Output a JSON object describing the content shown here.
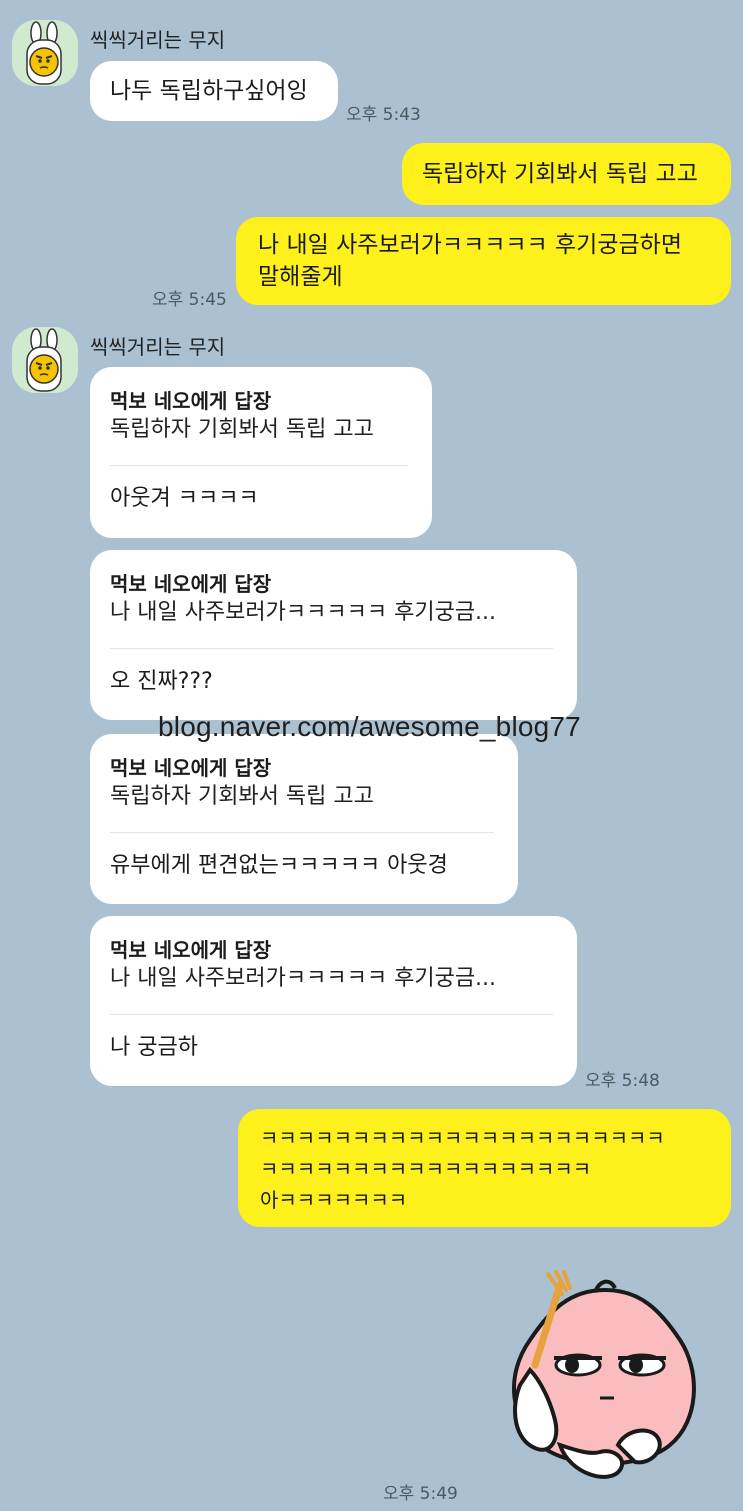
{
  "chat": {
    "group1": {
      "sender": "씩씩거리는 무지",
      "message": "나두 독립하구싶어잉",
      "time": "오후 5:43"
    },
    "outgoing1": {
      "message1": "독립하자 기회봐서 독립 고고",
      "message2_line1": "나 내일 사주보러가ㅋㅋㅋㅋㅋ 후기궁금하면",
      "message2_line2": "말해줄게",
      "time": "오후 5:45"
    },
    "group2": {
      "sender": "씩씩거리는 무지",
      "replies": [
        {
          "header": "먹보 네오에게 답장",
          "quote": "독립하자 기회봐서 독립 고고",
          "text": "아웃겨 ㅋㅋㅋㅋ"
        },
        {
          "header": "먹보 네오에게 답장",
          "quote": "나 내일 사주보러가ㅋㅋㅋㅋㅋ 후기궁금...",
          "text": "오 진짜???"
        },
        {
          "header": "먹보 네오에게 답장",
          "quote": "독립하자 기회봐서 독립 고고",
          "text": "유부에게 편견없는ㅋㅋㅋㅋㅋ 아웃경"
        },
        {
          "header": "먹보 네오에게 답장",
          "quote": "나 내일 사주보러가ㅋㅋㅋㅋㅋ 후기궁금...",
          "text": "나 궁금하"
        }
      ],
      "time": "오후 5:48"
    },
    "outgoing2": {
      "line1": "ㅋㅋㅋㅋㅋㅋㅋㅋㅋㅋㅋㅋㅋㅋㅋㅋㅋㅋㅋㅋㅋㅋ",
      "line2": "ㅋㅋㅋㅋㅋㅋㅋㅋㅋㅋㅋㅋㅋㅋㅋㅋㅋㅋ",
      "line3": "아ㅋㅋㅋㅋㅋㅋㅋ"
    },
    "sticker": {
      "icon": "apeach-sticker",
      "time": "오후 5:49"
    }
  },
  "watermark": "blog.naver.com/awesome_blog77",
  "colors": {
    "background": "#abc1d1",
    "incoming_bubble": "#ffffff",
    "outgoing_bubble": "#fef01b"
  }
}
